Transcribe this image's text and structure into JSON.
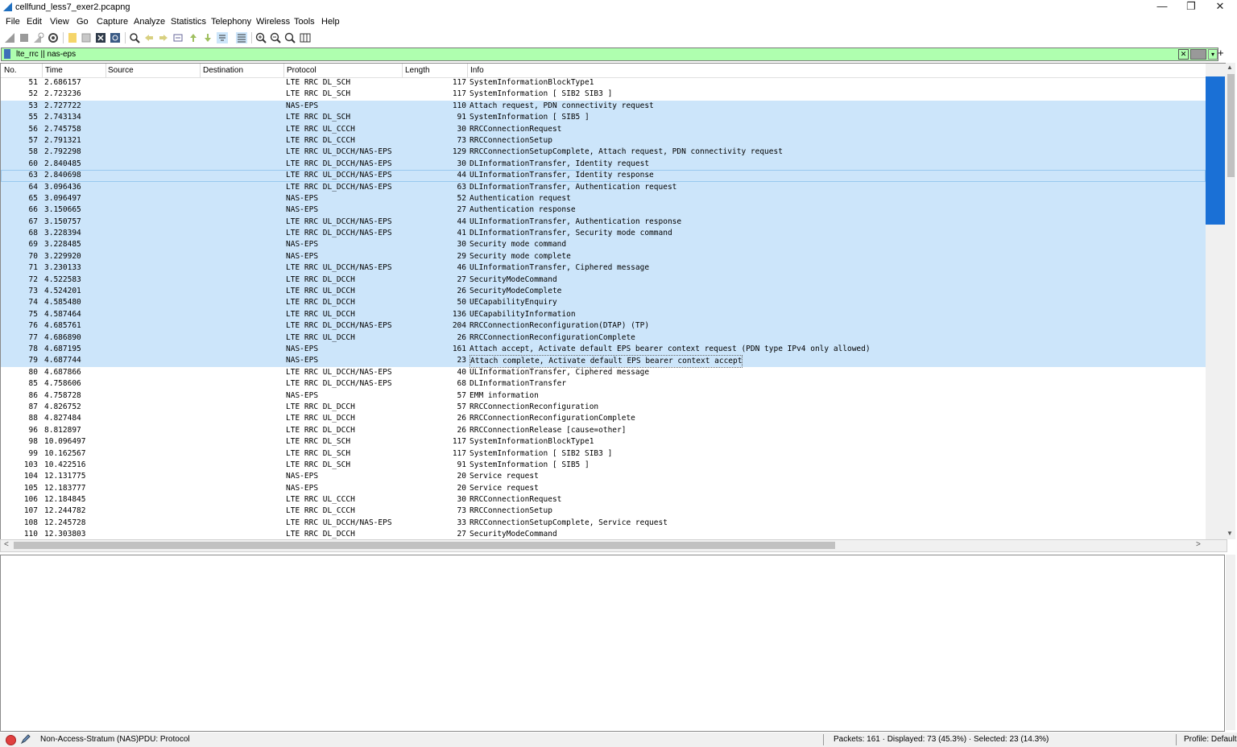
{
  "window": {
    "title": "cellfund_less7_exer2.pcapng",
    "minimize_glyph": "—",
    "restore_glyph": "❐",
    "close_glyph": "✕"
  },
  "menu": [
    "File",
    "Edit",
    "View",
    "Go",
    "Capture",
    "Analyze",
    "Statistics",
    "Telephony",
    "Wireless",
    "Tools",
    "Help"
  ],
  "filter": {
    "value": "lte_rrc || nas-eps",
    "bg_color": "#afffaf"
  },
  "columns": [
    "No.",
    "Time",
    "Source",
    "Destination",
    "Protocol",
    "Length",
    "Info"
  ],
  "packets": [
    {
      "no": "51",
      "time": "2.686157",
      "proto": "LTE RRC DL_SCH",
      "len": "117",
      "info": "SystemInformationBlockType1",
      "sel": false
    },
    {
      "no": "52",
      "time": "2.723236",
      "proto": "LTE RRC DL_SCH",
      "len": "117",
      "info": "SystemInformation [ SIB2 SIB3 ]",
      "sel": false
    },
    {
      "no": "53",
      "time": "2.727722",
      "proto": "NAS-EPS",
      "len": "110",
      "info": "Attach request, PDN connectivity request",
      "sel": true
    },
    {
      "no": "55",
      "time": "2.743134",
      "proto": "LTE RRC DL_SCH",
      "len": "91",
      "info": "SystemInformation [ SIB5 ]",
      "sel": true
    },
    {
      "no": "56",
      "time": "2.745758",
      "proto": "LTE RRC UL_CCCH",
      "len": "30",
      "info": "RRCConnectionRequest",
      "sel": true
    },
    {
      "no": "57",
      "time": "2.791321",
      "proto": "LTE RRC DL_CCCH",
      "len": "73",
      "info": "RRCConnectionSetup",
      "sel": true
    },
    {
      "no": "58",
      "time": "2.792298",
      "proto": "LTE RRC UL_DCCH/NAS-EPS",
      "len": "129",
      "info": "RRCConnectionSetupComplete, Attach request, PDN connectivity request",
      "sel": true
    },
    {
      "no": "60",
      "time": "2.840485",
      "proto": "LTE RRC DL_DCCH/NAS-EPS",
      "len": "30",
      "info": "DLInformationTransfer, Identity request",
      "sel": true
    },
    {
      "no": "63",
      "time": "2.840698",
      "proto": "LTE RRC UL_DCCH/NAS-EPS",
      "len": "44",
      "info": "ULInformationTransfer, Identity response",
      "sel": true,
      "cur": true
    },
    {
      "no": "64",
      "time": "3.096436",
      "proto": "LTE RRC DL_DCCH/NAS-EPS",
      "len": "63",
      "info": "DLInformationTransfer, Authentication request",
      "sel": true
    },
    {
      "no": "65",
      "time": "3.096497",
      "proto": "NAS-EPS",
      "len": "52",
      "info": "Authentication request",
      "sel": true
    },
    {
      "no": "66",
      "time": "3.150665",
      "proto": "NAS-EPS",
      "len": "27",
      "info": "Authentication response",
      "sel": true
    },
    {
      "no": "67",
      "time": "3.150757",
      "proto": "LTE RRC UL_DCCH/NAS-EPS",
      "len": "44",
      "info": "ULInformationTransfer, Authentication response",
      "sel": true
    },
    {
      "no": "68",
      "time": "3.228394",
      "proto": "LTE RRC DL_DCCH/NAS-EPS",
      "len": "41",
      "info": "DLInformationTransfer, Security mode command",
      "sel": true
    },
    {
      "no": "69",
      "time": "3.228485",
      "proto": "NAS-EPS",
      "len": "30",
      "info": "Security mode command",
      "sel": true
    },
    {
      "no": "70",
      "time": "3.229920",
      "proto": "NAS-EPS",
      "len": "29",
      "info": "Security mode complete",
      "sel": true
    },
    {
      "no": "71",
      "time": "3.230133",
      "proto": "LTE RRC UL_DCCH/NAS-EPS",
      "len": "46",
      "info": "ULInformationTransfer, Ciphered message",
      "sel": true
    },
    {
      "no": "72",
      "time": "4.522583",
      "proto": "LTE RRC DL_DCCH",
      "len": "27",
      "info": "SecurityModeCommand",
      "sel": true
    },
    {
      "no": "73",
      "time": "4.524201",
      "proto": "LTE RRC UL_DCCH",
      "len": "26",
      "info": "SecurityModeComplete",
      "sel": true
    },
    {
      "no": "74",
      "time": "4.585480",
      "proto": "LTE RRC DL_DCCH",
      "len": "50",
      "info": "UECapabilityEnquiry",
      "sel": true
    },
    {
      "no": "75",
      "time": "4.587464",
      "proto": "LTE RRC UL_DCCH",
      "len": "136",
      "info": "UECapabilityInformation",
      "sel": true
    },
    {
      "no": "76",
      "time": "4.685761",
      "proto": "LTE RRC DL_DCCH/NAS-EPS",
      "len": "204",
      "info": "RRCConnectionReconfiguration(DTAP) (TP)",
      "sel": true
    },
    {
      "no": "77",
      "time": "4.686890",
      "proto": "LTE RRC UL_DCCH",
      "len": "26",
      "info": "RRCConnectionReconfigurationComplete",
      "sel": true
    },
    {
      "no": "78",
      "time": "4.687195",
      "proto": "NAS-EPS",
      "len": "161",
      "info": "Attach accept, Activate default EPS bearer context request (PDN type IPv4 only allowed)",
      "sel": true
    },
    {
      "no": "79",
      "time": "4.687744",
      "proto": "NAS-EPS",
      "len": "23",
      "info": "Attach complete, Activate default EPS bearer context accept",
      "sel": true,
      "box": true
    },
    {
      "no": "80",
      "time": "4.687866",
      "proto": "LTE RRC UL_DCCH/NAS-EPS",
      "len": "40",
      "info": "ULInformationTransfer, Ciphered message",
      "sel": false
    },
    {
      "no": "85",
      "time": "4.758606",
      "proto": "LTE RRC DL_DCCH/NAS-EPS",
      "len": "68",
      "info": "DLInformationTransfer",
      "sel": false
    },
    {
      "no": "86",
      "time": "4.758728",
      "proto": "NAS-EPS",
      "len": "57",
      "info": "EMM information",
      "sel": false
    },
    {
      "no": "87",
      "time": "4.826752",
      "proto": "LTE RRC DL_DCCH",
      "len": "57",
      "info": "RRCConnectionReconfiguration",
      "sel": false
    },
    {
      "no": "88",
      "time": "4.827484",
      "proto": "LTE RRC UL_DCCH",
      "len": "26",
      "info": "RRCConnectionReconfigurationComplete",
      "sel": false
    },
    {
      "no": "96",
      "time": "8.812897",
      "proto": "LTE RRC DL_DCCH",
      "len": "26",
      "info": "RRCConnectionRelease [cause=other]",
      "sel": false
    },
    {
      "no": "98",
      "time": "10.096497",
      "proto": "LTE RRC DL_SCH",
      "len": "117",
      "info": "SystemInformationBlockType1",
      "sel": false
    },
    {
      "no": "99",
      "time": "10.162567",
      "proto": "LTE RRC DL_SCH",
      "len": "117",
      "info": "SystemInformation [ SIB2 SIB3 ]",
      "sel": false
    },
    {
      "no": "103",
      "time": "10.422516",
      "proto": "LTE RRC DL_SCH",
      "len": "91",
      "info": "SystemInformation [ SIB5 ]",
      "sel": false
    },
    {
      "no": "104",
      "time": "12.131775",
      "proto": "NAS-EPS",
      "len": "20",
      "info": "Service request",
      "sel": false
    },
    {
      "no": "105",
      "time": "12.183777",
      "proto": "NAS-EPS",
      "len": "20",
      "info": "Service request",
      "sel": false
    },
    {
      "no": "106",
      "time": "12.184845",
      "proto": "LTE RRC UL_CCCH",
      "len": "30",
      "info": "RRCConnectionRequest",
      "sel": false
    },
    {
      "no": "107",
      "time": "12.244782",
      "proto": "LTE RRC DL_CCCH",
      "len": "73",
      "info": "RRCConnectionSetup",
      "sel": false
    },
    {
      "no": "108",
      "time": "12.245728",
      "proto": "LTE RRC UL_DCCH/NAS-EPS",
      "len": "33",
      "info": "RRCConnectionSetupComplete, Service request",
      "sel": false
    },
    {
      "no": "110",
      "time": "12.303803",
      "proto": "LTE RRC DL_DCCH",
      "len": "27",
      "info": "SecurityModeCommand",
      "sel": false
    }
  ],
  "selection_color": "#cce5fa",
  "status": {
    "protocol_text": "Non-Access-Stratum (NAS)PDU: Protocol",
    "packets_text": "Packets: 161 · Displayed: 73 (45.3%) · Selected: 23 (14.3%)",
    "profile_text": "Profile: Default"
  },
  "glyphs": {
    "filter_clear": "✕",
    "filter_dropdown": "▾",
    "filter_add": "+",
    "scroll_up": "▲",
    "scroll_down": "▼",
    "scroll_left": "<",
    "scroll_right": ">"
  }
}
